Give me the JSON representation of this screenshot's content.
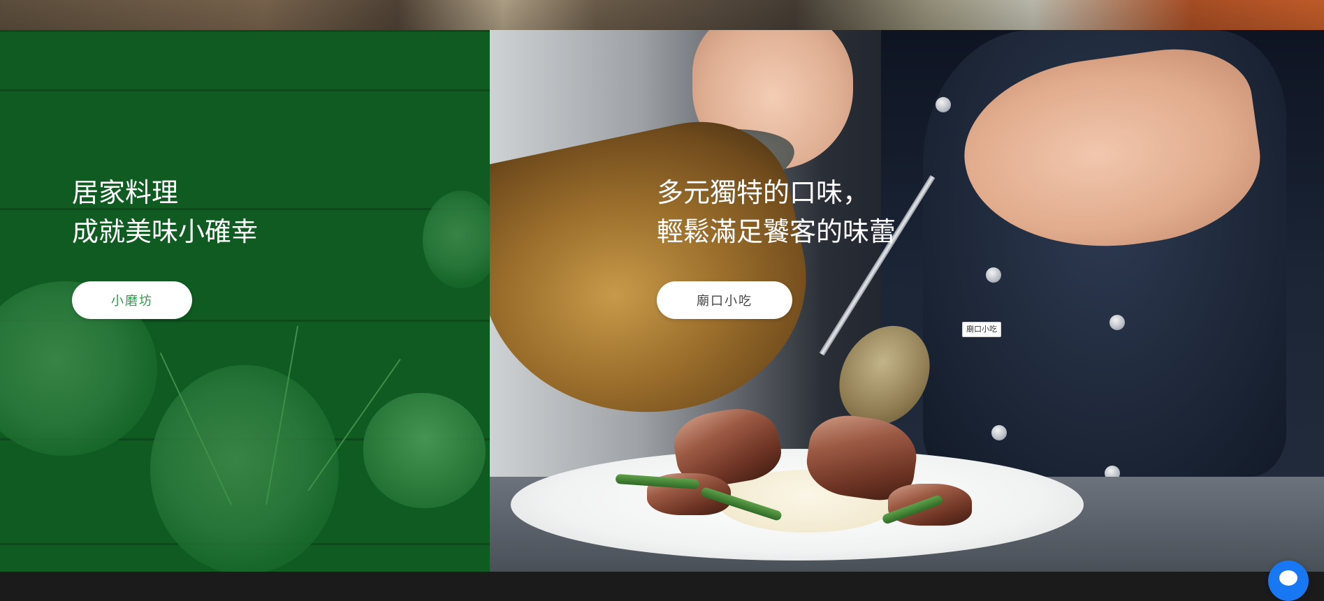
{
  "left_panel": {
    "heading_lines": [
      "居家料理",
      "成就美味小確幸"
    ],
    "button_label": "小磨坊",
    "button_text_color": "#2e9a4a",
    "background_color": "#0f5b22"
  },
  "right_panel": {
    "heading_lines": [
      "多元獨特的口味，",
      "輕鬆滿足饕客的味蕾"
    ],
    "button_label": "廟口小吃",
    "button_text_color": "#444444"
  },
  "tooltip": {
    "text": "廟口小吃"
  },
  "chat": {
    "icon": "chat-bubble-icon"
  }
}
